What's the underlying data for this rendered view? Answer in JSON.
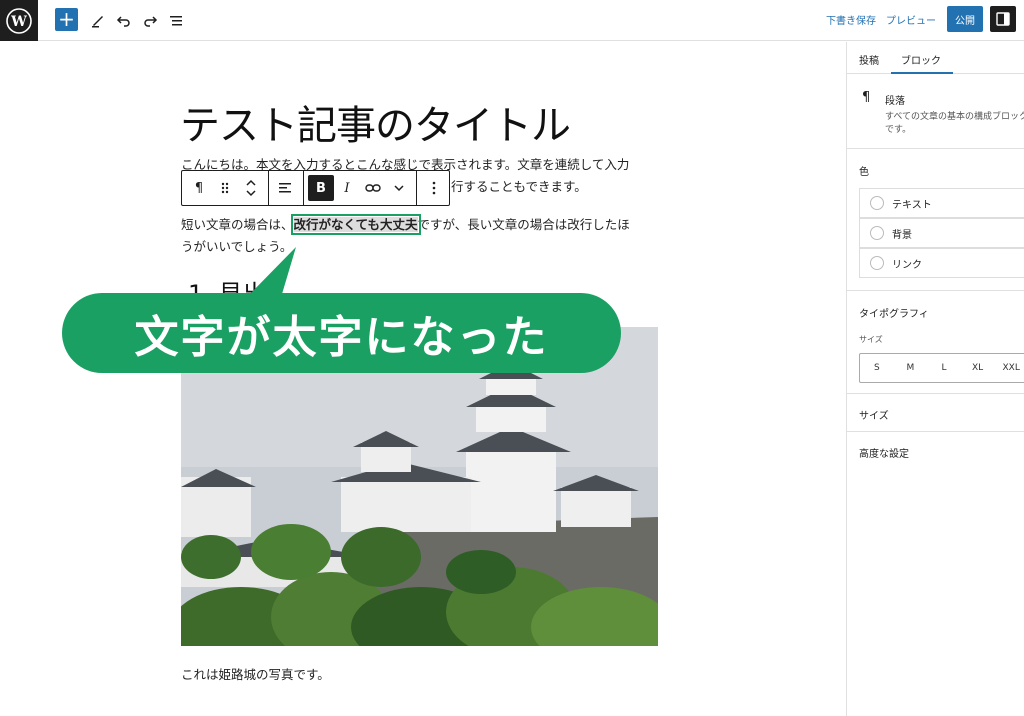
{
  "toolbar": {
    "add_label": "+",
    "save_draft": "下書き保存",
    "preview": "プレビュー",
    "publish": "公開"
  },
  "editor": {
    "title": "テスト記事のタイトル",
    "para1_line1": "こんにちは。本文を入力するとこんな感じで表示されます。文章を連続して入力",
    "para1_line2": "行することもできます。",
    "para2_before": "短い文章の場合は、",
    "para2_bold": "改行がなくても大丈夫",
    "para2_after": "ですが、長い文章の場合は改行したほ",
    "para2_line2": "うがいいでしょう。",
    "heading": "1. 見出し",
    "caption": "これは姫路城の写真です。"
  },
  "block_toolbar": {
    "paragraph_icon": "¶",
    "bold": "B",
    "italic": "I"
  },
  "callout": {
    "text": "文字が太字になった"
  },
  "sidebar": {
    "tab_post": "投稿",
    "tab_block": "ブロック",
    "block_name": "段落",
    "block_desc_line1": "すべての文章の基本の構成ブロック",
    "block_desc_line2": "です。",
    "color_heading": "色",
    "color_text": "テキスト",
    "color_background": "背景",
    "color_link": "リンク",
    "typography_heading": "タイポグラフィ",
    "size_label": "サイズ",
    "sizes": [
      "S",
      "M",
      "L",
      "XL",
      "XXL"
    ],
    "dimensions_heading": "サイズ",
    "advanced_heading": "高度な設定"
  },
  "colors": {
    "accent": "#2271b1",
    "callout_green": "#1aa063",
    "dark": "#1e1e1e"
  }
}
